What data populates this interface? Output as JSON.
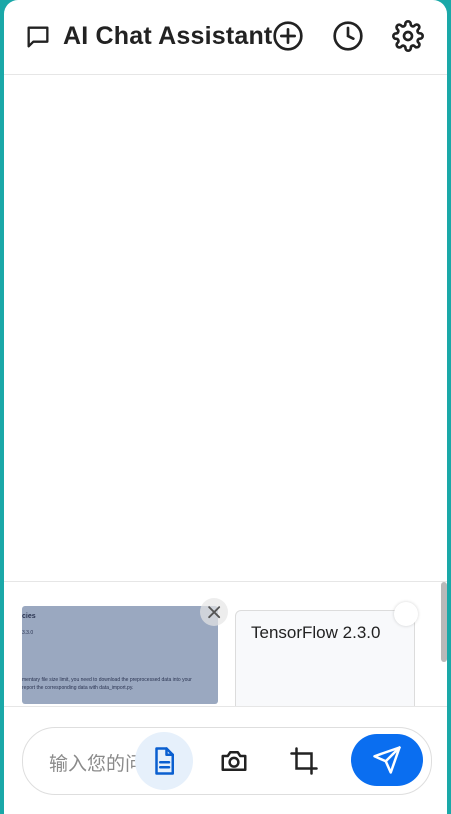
{
  "header": {
    "title": "AI Chat Assistant",
    "icons": [
      "chat-bubble-icon",
      "plus-circle-icon",
      "clock-icon",
      "gear-icon"
    ]
  },
  "attachments": {
    "image_preview": {
      "line1": "cies",
      "line2": "3.3.0",
      "line3": "mentary file size limit, you need to download the preprocessed data into your",
      "line4": "report the corresponding data with data_import.py."
    },
    "file_card": {
      "title": "TensorFlow 2.3.0"
    }
  },
  "composer": {
    "placeholder": "输入您的问题...",
    "tools": [
      "document-icon",
      "camera-icon",
      "crop-icon"
    ],
    "send_icon": "send-icon"
  },
  "colors": {
    "accent": "#0a6ef0",
    "frame": "#1aa8a8",
    "doc_highlight": "#e6f0fb"
  }
}
